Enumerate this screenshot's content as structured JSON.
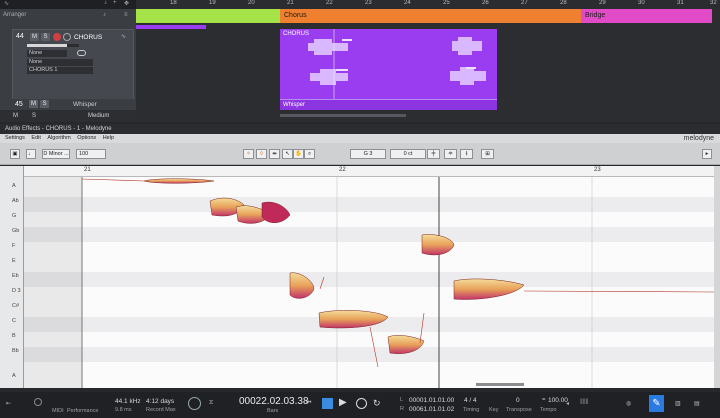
{
  "arranger": {
    "label": "Arranger",
    "ruler_numbers": [
      "18",
      "19",
      "20",
      "21",
      "22",
      "23",
      "24",
      "25",
      "26",
      "27",
      "28",
      "29",
      "30",
      "31",
      "32"
    ],
    "sections": [
      {
        "name": "",
        "color": "#a6e348"
      },
      {
        "name": "Chorus",
        "color": "#ee8030"
      },
      {
        "name": "Bridge",
        "color": "#e24bc8"
      }
    ],
    "track": {
      "number": "44",
      "m": "M",
      "s": "S",
      "name": "CHORUS",
      "input": "None",
      "output": "None",
      "channel": "CHORUS 1"
    },
    "track2": {
      "number": "45",
      "m": "M",
      "s": "S",
      "name": "Whisper"
    },
    "footer": {
      "m": "M",
      "s": "S",
      "size": "Medium"
    },
    "clips": {
      "chorus": "CHORUS",
      "whisper": "Whisper"
    }
  },
  "audio_effects": {
    "title": "Audio Effects - CHORUS - 1 - Melodyne",
    "menu": [
      "Settings",
      "Edit",
      "Algorithm",
      "Options",
      "Help"
    ],
    "logo": "melodyne",
    "scale": "D Minor ...",
    "tempo": "100",
    "note": "G 3",
    "cents": "0 ct",
    "bars": [
      "21",
      "22",
      "23"
    ],
    "keys": [
      "A",
      "Ab",
      "G",
      "Gb",
      "F",
      "E",
      "Eb",
      "D 3",
      "C#",
      "C",
      "B",
      "Bb",
      "A"
    ]
  },
  "transport": {
    "sample_rate": "44.1 kHz",
    "latency": "9.8 ms",
    "midi": "MIDI",
    "performance": "Performance",
    "record_time": "4:12 days",
    "record_label": "Record Max",
    "position": "00022.02.03.38",
    "bars_label": "Bars",
    "loop_l": "00001.01.01.00",
    "loop_r": "00061.01.01.02",
    "l_label": "L",
    "r_label": "R",
    "timesig": "4 / 4",
    "timing_label": "Timing",
    "key_label": "Key",
    "transpose_value": "0",
    "transpose_label": "Transpose",
    "tempo": "100.00",
    "tempo_label": "Tempo"
  }
}
